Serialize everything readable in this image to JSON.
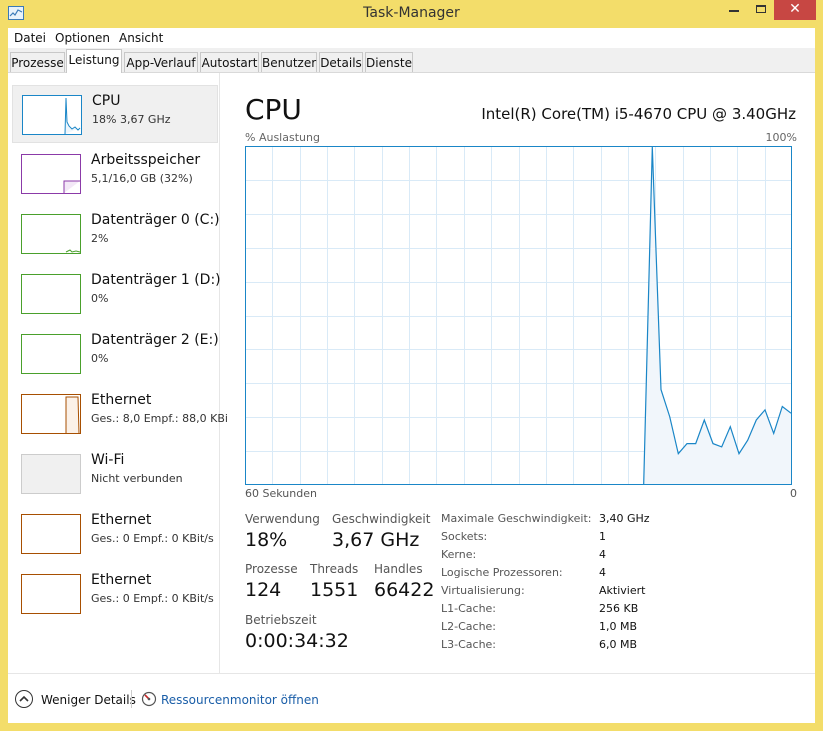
{
  "window": {
    "title": "Task-Manager"
  },
  "menu": [
    "Datei",
    "Optionen",
    "Ansicht"
  ],
  "tabs": [
    "Prozesse",
    "Leistung",
    "App-Verlauf",
    "Autostart",
    "Benutzer",
    "Details",
    "Dienste"
  ],
  "active_tab": "Leistung",
  "sidebar": {
    "items": [
      {
        "title": "CPU",
        "sub": "18% 3,67 GHz",
        "color": "#1a86c7"
      },
      {
        "title": "Arbeitsspeicher",
        "sub": "5,1/16,0 GB (32%)",
        "color": "#8b3aa8"
      },
      {
        "title": "Datenträger 0 (C:)",
        "sub": "2%",
        "color": "#4aa02c"
      },
      {
        "title": "Datenträger 1 (D:)",
        "sub": "0%",
        "color": "#4aa02c"
      },
      {
        "title": "Datenträger 2 (E:)",
        "sub": "0%",
        "color": "#4aa02c"
      },
      {
        "title": "Ethernet",
        "sub": "Ges.: 8,0 Empf.: 88,0 KBi",
        "color": "#a74f01"
      },
      {
        "title": "Wi-Fi",
        "sub": "Nicht verbunden",
        "color": "#cccccc"
      },
      {
        "title": "Ethernet",
        "sub": "Ges.: 0 Empf.: 0 KBit/s",
        "color": "#a74f01"
      },
      {
        "title": "Ethernet",
        "sub": "Ges.: 0 Empf.: 0 KBit/s",
        "color": "#a74f01"
      }
    ]
  },
  "cpu": {
    "title": "CPU",
    "model": "Intel(R) Core(TM) i5-4670 CPU @ 3.40GHz",
    "y_label": "% Auslastung",
    "y_max_label": "100%",
    "x_left_label": "60 Sekunden",
    "x_right_label": "0",
    "line_color": "#1a86c7",
    "grid_color": "#d9eaf7",
    "fill_color": "#f1f6fb",
    "usage_history_percent": [
      0,
      0,
      0,
      0,
      0,
      0,
      0,
      0,
      0,
      0,
      0,
      0,
      0,
      0,
      0,
      0,
      0,
      0,
      0,
      0,
      0,
      0,
      0,
      0,
      0,
      0,
      0,
      0,
      0,
      0,
      0,
      0,
      0,
      0,
      0,
      0,
      0,
      0,
      0,
      0,
      0,
      0,
      0,
      0,
      0,
      0,
      0,
      100,
      28,
      20,
      9,
      12,
      12,
      19,
      12,
      11,
      17,
      9,
      13,
      19,
      22,
      15,
      23,
      21
    ],
    "stats": [
      {
        "label": "Verwendung",
        "value": "18%"
      },
      {
        "label": "Geschwindigkeit",
        "value": "3,67 GHz"
      },
      {
        "label": "Prozesse",
        "value": "124"
      },
      {
        "label": "Threads",
        "value": "1551"
      },
      {
        "label": "Handles",
        "value": "66422"
      },
      {
        "label": "Betriebszeit",
        "value": "0:00:34:32"
      }
    ],
    "specs": [
      {
        "k": "Maximale Geschwindigkeit:",
        "v": "3,40 GHz"
      },
      {
        "k": "Sockets:",
        "v": "1"
      },
      {
        "k": "Kerne:",
        "v": "4"
      },
      {
        "k": "Logische Prozessoren:",
        "v": "4"
      },
      {
        "k": "Virtualisierung:",
        "v": "Aktiviert"
      },
      {
        "k": "L1-Cache:",
        "v": "256 KB"
      },
      {
        "k": "L2-Cache:",
        "v": "1,0 MB"
      },
      {
        "k": "L3-Cache:",
        "v": "6,0 MB"
      }
    ]
  },
  "footer": {
    "less_details": "Weniger Details",
    "resource_monitor": "Ressourcenmonitor öffnen"
  }
}
